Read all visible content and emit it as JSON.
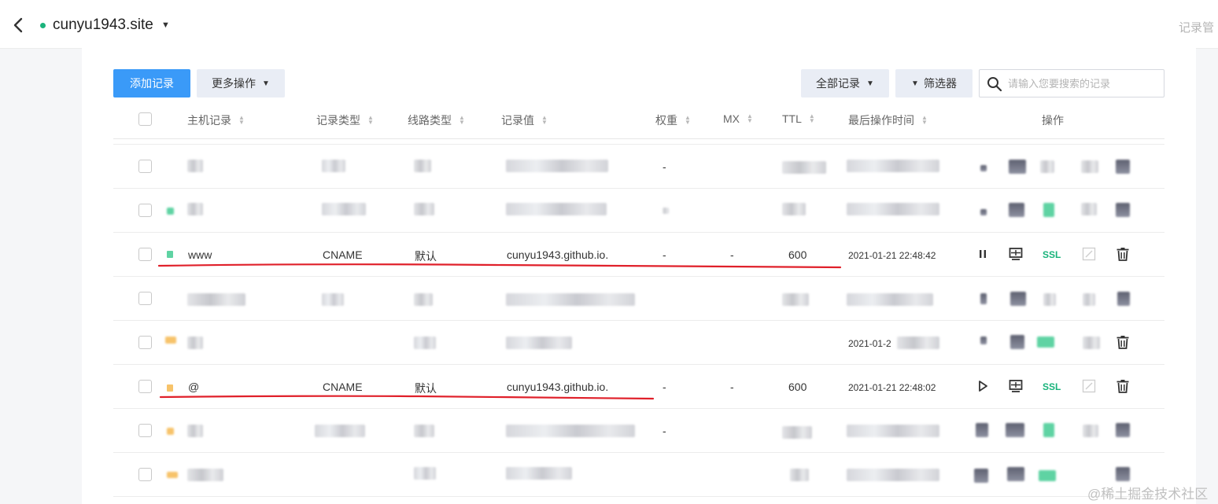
{
  "header": {
    "domain": "cunyu1943.site",
    "right_crumb": "记录管"
  },
  "toolbar": {
    "add_label": "添加记录",
    "more_label": "更多操作",
    "all_label": "全部记录",
    "filter_label": "筛选器",
    "search_placeholder": "请输入您要搜索的记录"
  },
  "table": {
    "columns": [
      "主机记录",
      "记录类型",
      "线路类型",
      "记录值",
      "权重",
      "MX",
      "TTL",
      "最后操作时间",
      "操作"
    ],
    "rows": [
      {
        "masked": true,
        "weight": "-"
      },
      {
        "masked": true
      },
      {
        "host": "www",
        "type": "CNAME",
        "line": "默认",
        "value": "cunyu1943.github.io.",
        "weight": "-",
        "mx": "-",
        "ttl": "600",
        "time": "2021-01-21 22:48:42",
        "status_color": "#5fd3a3",
        "ssl": "SSL",
        "toggle_action": "pause"
      },
      {
        "masked": true
      },
      {
        "masked": true,
        "time_partial": "2021-01-2"
      },
      {
        "host": "@",
        "type": "CNAME",
        "line": "默认",
        "value": "cunyu1943.github.io.",
        "weight": "-",
        "mx": "-",
        "ttl": "600",
        "time": "2021-01-21 22:48:02",
        "status_color": "#f7c36a",
        "ssl": "SSL",
        "toggle_action": "play"
      },
      {
        "masked": true,
        "weight": "-"
      },
      {
        "masked": true
      }
    ]
  },
  "annotation_color": "#e0202a",
  "watermark": "@稀土掘金技术社区"
}
